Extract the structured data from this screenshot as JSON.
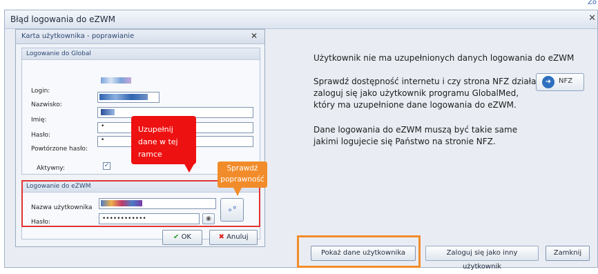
{
  "corner_link": "Zo",
  "main_dialog": {
    "title": "Błąd logowania do eZWM",
    "close_glyph": "✕"
  },
  "user_card": {
    "title": "Karta użytkownika - poprawianie",
    "close_glyph": "✕",
    "global_section": {
      "title": "Logowanie do Global",
      "labels": {
        "login": "Login:",
        "surname": "Nazwisko:",
        "name": "Imię:",
        "password": "Hasło:",
        "password_repeat": "Powtórzone hasło:",
        "active": "Aktywny:"
      },
      "values": {
        "password": "•",
        "password_repeat": "•"
      },
      "active_check": "✓"
    },
    "ezwm_section": {
      "title": "Logowanie do eZWM",
      "labels": {
        "username": "Nazwa użytkownika",
        "password": "Hasło:"
      },
      "values": {
        "password": "••••••••••••"
      }
    },
    "buttons": {
      "ok": "OK",
      "cancel": "Anuluj"
    }
  },
  "callouts": {
    "red": "Uzupełnij dane w tej ramce",
    "orange": "Sprawdź poprawność"
  },
  "messages": {
    "line1": "Użytkownik nie ma uzupełnionych danych logowania do eZWM",
    "para2": "Sprawdź dostępność internetu i czy strona NFZ działa, zaloguj się jako użytkownik programu GlobalMed, który ma uzupełnione dane logowania do eZWM.",
    "para3": "Dane logowania do eZWM muszą być takie same jakimi logujecie się Państwo na stronie NFZ."
  },
  "nfz_button": "NFZ",
  "bottom_buttons": {
    "show_user": "Pokaż dane użytkownika",
    "login_other": "Zaloguj się jako inny użytkownik",
    "close": "Zamknij"
  },
  "colors": {
    "callout_red": "#ee1111",
    "callout_orange": "#f28c2a",
    "highlight_frame": "#e23232"
  }
}
